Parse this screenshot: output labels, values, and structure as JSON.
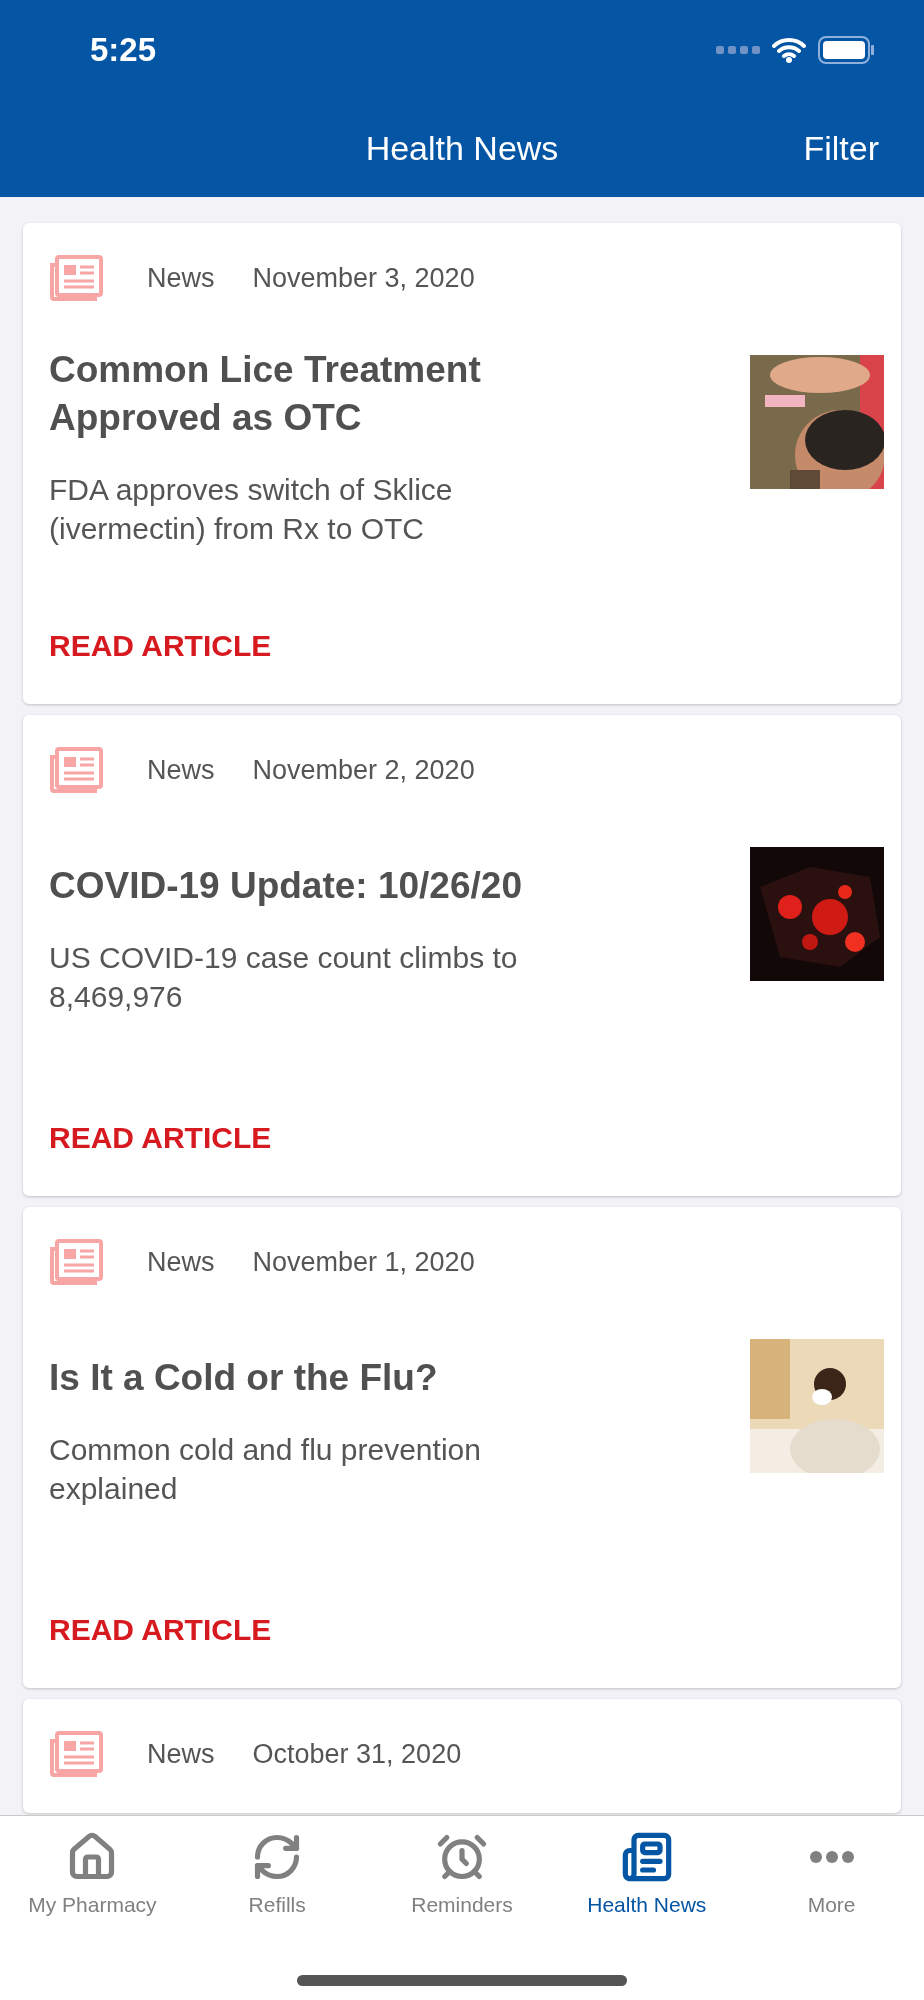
{
  "status_bar": {
    "time": "5:25"
  },
  "nav_bar": {
    "title": "Health News",
    "action": "Filter"
  },
  "articles": [
    {
      "category": "News",
      "date": "November 3, 2020",
      "title": "Common Lice Treatment Approved as OTC",
      "summary": "FDA approves switch of Sklice (ivermectin) from Rx to OTC",
      "link": "READ ARTICLE"
    },
    {
      "category": "News",
      "date": "November 2, 2020",
      "title": "COVID-19 Update: 10/26/20",
      "summary": "US COVID-19 case count climbs to 8,469,976",
      "link": "READ ARTICLE"
    },
    {
      "category": "News",
      "date": "November 1, 2020",
      "title": "Is It a Cold or the Flu?",
      "summary": "Common cold and flu prevention explained",
      "link": "READ ARTICLE"
    },
    {
      "category": "News",
      "date": "October 31, 2020"
    }
  ],
  "tab_bar": [
    {
      "label": "My Pharmacy",
      "selected": false
    },
    {
      "label": "Refills",
      "selected": false
    },
    {
      "label": "Reminders",
      "selected": false
    },
    {
      "label": "Health News",
      "selected": true
    },
    {
      "label": "More",
      "selected": false
    }
  ]
}
